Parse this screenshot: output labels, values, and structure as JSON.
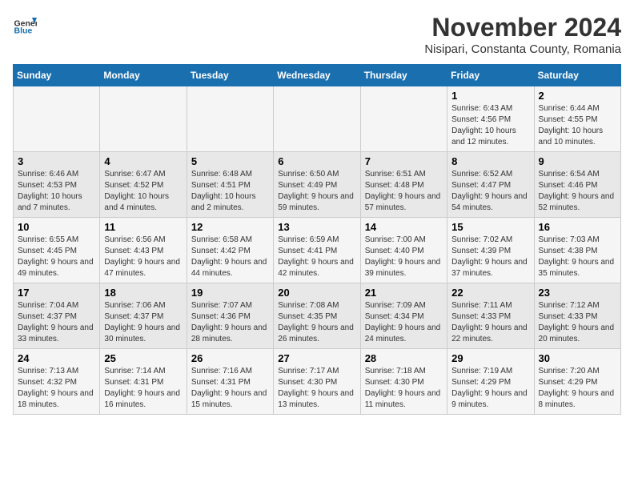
{
  "logo": {
    "general": "General",
    "blue": "Blue"
  },
  "header": {
    "title": "November 2024",
    "subtitle": "Nisipari, Constanta County, Romania"
  },
  "weekdays": [
    "Sunday",
    "Monday",
    "Tuesday",
    "Wednesday",
    "Thursday",
    "Friday",
    "Saturday"
  ],
  "weeks": [
    [
      {
        "day": "",
        "info": ""
      },
      {
        "day": "",
        "info": ""
      },
      {
        "day": "",
        "info": ""
      },
      {
        "day": "",
        "info": ""
      },
      {
        "day": "",
        "info": ""
      },
      {
        "day": "1",
        "info": "Sunrise: 6:43 AM\nSunset: 4:56 PM\nDaylight: 10 hours and 12 minutes."
      },
      {
        "day": "2",
        "info": "Sunrise: 6:44 AM\nSunset: 4:55 PM\nDaylight: 10 hours and 10 minutes."
      }
    ],
    [
      {
        "day": "3",
        "info": "Sunrise: 6:46 AM\nSunset: 4:53 PM\nDaylight: 10 hours and 7 minutes."
      },
      {
        "day": "4",
        "info": "Sunrise: 6:47 AM\nSunset: 4:52 PM\nDaylight: 10 hours and 4 minutes."
      },
      {
        "day": "5",
        "info": "Sunrise: 6:48 AM\nSunset: 4:51 PM\nDaylight: 10 hours and 2 minutes."
      },
      {
        "day": "6",
        "info": "Sunrise: 6:50 AM\nSunset: 4:49 PM\nDaylight: 9 hours and 59 minutes."
      },
      {
        "day": "7",
        "info": "Sunrise: 6:51 AM\nSunset: 4:48 PM\nDaylight: 9 hours and 57 minutes."
      },
      {
        "day": "8",
        "info": "Sunrise: 6:52 AM\nSunset: 4:47 PM\nDaylight: 9 hours and 54 minutes."
      },
      {
        "day": "9",
        "info": "Sunrise: 6:54 AM\nSunset: 4:46 PM\nDaylight: 9 hours and 52 minutes."
      }
    ],
    [
      {
        "day": "10",
        "info": "Sunrise: 6:55 AM\nSunset: 4:45 PM\nDaylight: 9 hours and 49 minutes."
      },
      {
        "day": "11",
        "info": "Sunrise: 6:56 AM\nSunset: 4:43 PM\nDaylight: 9 hours and 47 minutes."
      },
      {
        "day": "12",
        "info": "Sunrise: 6:58 AM\nSunset: 4:42 PM\nDaylight: 9 hours and 44 minutes."
      },
      {
        "day": "13",
        "info": "Sunrise: 6:59 AM\nSunset: 4:41 PM\nDaylight: 9 hours and 42 minutes."
      },
      {
        "day": "14",
        "info": "Sunrise: 7:00 AM\nSunset: 4:40 PM\nDaylight: 9 hours and 39 minutes."
      },
      {
        "day": "15",
        "info": "Sunrise: 7:02 AM\nSunset: 4:39 PM\nDaylight: 9 hours and 37 minutes."
      },
      {
        "day": "16",
        "info": "Sunrise: 7:03 AM\nSunset: 4:38 PM\nDaylight: 9 hours and 35 minutes."
      }
    ],
    [
      {
        "day": "17",
        "info": "Sunrise: 7:04 AM\nSunset: 4:37 PM\nDaylight: 9 hours and 33 minutes."
      },
      {
        "day": "18",
        "info": "Sunrise: 7:06 AM\nSunset: 4:37 PM\nDaylight: 9 hours and 30 minutes."
      },
      {
        "day": "19",
        "info": "Sunrise: 7:07 AM\nSunset: 4:36 PM\nDaylight: 9 hours and 28 minutes."
      },
      {
        "day": "20",
        "info": "Sunrise: 7:08 AM\nSunset: 4:35 PM\nDaylight: 9 hours and 26 minutes."
      },
      {
        "day": "21",
        "info": "Sunrise: 7:09 AM\nSunset: 4:34 PM\nDaylight: 9 hours and 24 minutes."
      },
      {
        "day": "22",
        "info": "Sunrise: 7:11 AM\nSunset: 4:33 PM\nDaylight: 9 hours and 22 minutes."
      },
      {
        "day": "23",
        "info": "Sunrise: 7:12 AM\nSunset: 4:33 PM\nDaylight: 9 hours and 20 minutes."
      }
    ],
    [
      {
        "day": "24",
        "info": "Sunrise: 7:13 AM\nSunset: 4:32 PM\nDaylight: 9 hours and 18 minutes."
      },
      {
        "day": "25",
        "info": "Sunrise: 7:14 AM\nSunset: 4:31 PM\nDaylight: 9 hours and 16 minutes."
      },
      {
        "day": "26",
        "info": "Sunrise: 7:16 AM\nSunset: 4:31 PM\nDaylight: 9 hours and 15 minutes."
      },
      {
        "day": "27",
        "info": "Sunrise: 7:17 AM\nSunset: 4:30 PM\nDaylight: 9 hours and 13 minutes."
      },
      {
        "day": "28",
        "info": "Sunrise: 7:18 AM\nSunset: 4:30 PM\nDaylight: 9 hours and 11 minutes."
      },
      {
        "day": "29",
        "info": "Sunrise: 7:19 AM\nSunset: 4:29 PM\nDaylight: 9 hours and 9 minutes."
      },
      {
        "day": "30",
        "info": "Sunrise: 7:20 AM\nSunset: 4:29 PM\nDaylight: 9 hours and 8 minutes."
      }
    ]
  ]
}
